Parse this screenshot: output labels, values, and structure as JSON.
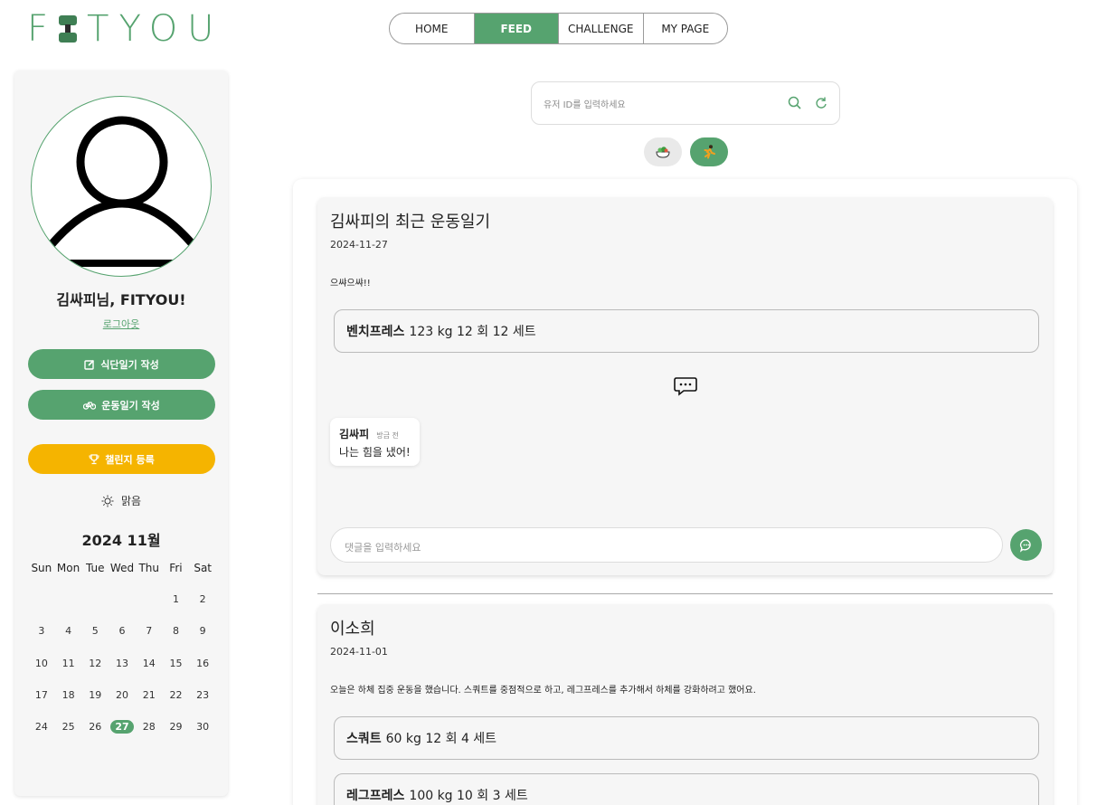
{
  "logo": {
    "left": "F",
    "right": "TYOU"
  },
  "nav": {
    "tabs": [
      {
        "label": "HOME",
        "active": false
      },
      {
        "label": "FEED",
        "active": true
      },
      {
        "label": "CHALLENGE",
        "active": false
      },
      {
        "label": "MY PAGE",
        "active": false
      }
    ]
  },
  "sidebar": {
    "greeting": "김싸피님, FITYOU!",
    "logout": "로그아웃",
    "buttons": {
      "diet": "식단일기 작성",
      "exercise": "운동일기 작성",
      "challenge": "챌린지 등록"
    },
    "weather": "맑음",
    "calendar": {
      "title": "2024 11월",
      "weekdays": [
        "Sun",
        "Mon",
        "Tue",
        "Wed",
        "Thu",
        "Fri",
        "Sat"
      ],
      "weeks": [
        [
          "",
          "",
          "",
          "",
          "",
          "1",
          "2"
        ],
        [
          "3",
          "4",
          "5",
          "6",
          "7",
          "8",
          "9"
        ],
        [
          "10",
          "11",
          "12",
          "13",
          "14",
          "15",
          "16"
        ],
        [
          "17",
          "18",
          "19",
          "20",
          "21",
          "22",
          "23"
        ],
        [
          "24",
          "25",
          "26",
          "27",
          "28",
          "29",
          "30"
        ]
      ],
      "today": "27"
    }
  },
  "search": {
    "placeholder": "유저 ID를 입력하세요"
  },
  "colors": {
    "accent": "#56a36f",
    "challenge": "#f5b400"
  },
  "feed": {
    "posts": [
      {
        "title": "김싸피의 최근 운동일기",
        "date": "2024-11-27",
        "body": "으쌰으쌰!!",
        "exercises": [
          {
            "name": "벤치프레스",
            "detail": "123 kg 12 회 12 세트"
          }
        ],
        "comments": [
          {
            "user": "김싸피",
            "time": "방금 전",
            "text": "나는 힘을 냈어!"
          }
        ],
        "comment_placeholder": "댓글을 입력하세요"
      },
      {
        "title": "이소희",
        "date": "2024-11-01",
        "body": "오늘은 하체 집중 운동을 했습니다. 스쿼트를 중점적으로 하고, 레그프레스를 추가해서 하체를 강화하려고 했어요.",
        "exercises": [
          {
            "name": "스쿼트",
            "detail": "60 kg 12 회 4 세트"
          },
          {
            "name": "레그프레스",
            "detail": "100 kg 10 회 3 세트"
          }
        ]
      }
    ]
  }
}
